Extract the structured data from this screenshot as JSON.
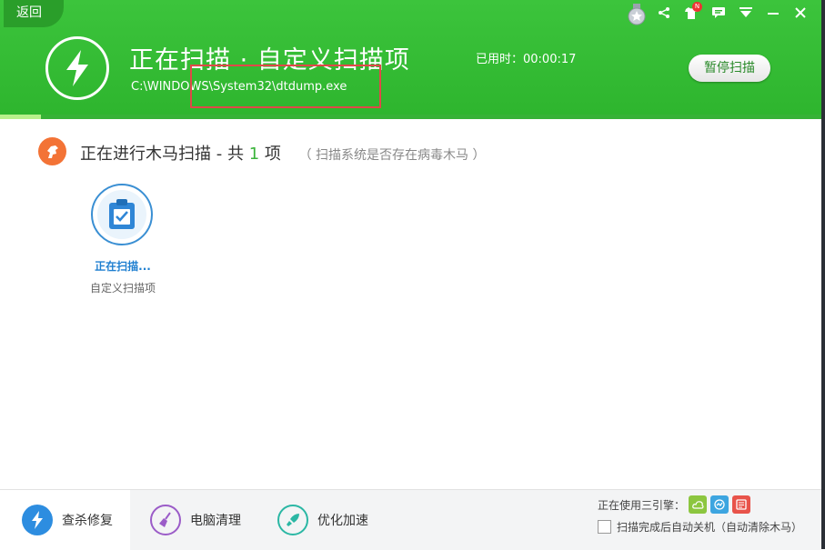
{
  "header": {
    "back_label": "返回",
    "title": "正在扫描 · 自定义扫描项",
    "current_path": "C:\\WINDOWS\\System32\\dtdump.exe",
    "elapsed": "已用时：00:00:17",
    "pause_label": "暂停扫描",
    "notification_badge": "N",
    "progress": 0.05
  },
  "section": {
    "title": "正在进行木马扫描 - 共",
    "count": "1",
    "unit": "项",
    "note": "（ 扫描系统是否存在病毒木马 ）"
  },
  "item": {
    "status": "正在扫描...",
    "label": "自定义扫描项"
  },
  "tabs": [
    {
      "label": "查杀修复",
      "icon": "lightning-icon",
      "color": "#2d8de0"
    },
    {
      "label": "电脑清理",
      "icon": "broom-icon",
      "color": "#9b5cc8"
    },
    {
      "label": "优化加速",
      "icon": "rocket-icon",
      "color": "#2bb7a4"
    }
  ],
  "engines": {
    "label": "正在使用三引擎：",
    "colors": [
      "#8cc63f",
      "#3da5e0",
      "#e8534a"
    ]
  },
  "shutdown_label": "扫描完成后自动关机（自动清除木马）",
  "colors": {
    "brand_green": "#2eb52e",
    "accent_orange": "#f37336",
    "accent_blue": "#3a8fd3"
  }
}
